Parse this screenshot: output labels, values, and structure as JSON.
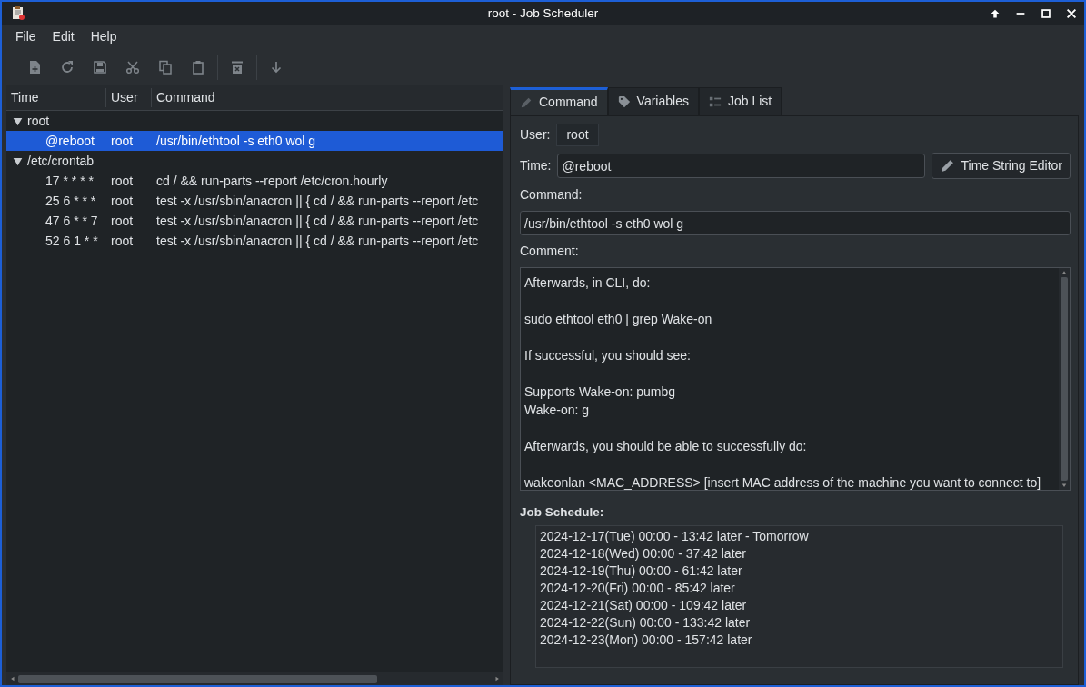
{
  "window": {
    "title": "root - Job Scheduler"
  },
  "menu": [
    "File",
    "Edit",
    "Help"
  ],
  "toolbar": [
    {
      "kind": "new"
    },
    {
      "kind": "reload"
    },
    {
      "kind": "save"
    },
    {
      "kind": "sep"
    },
    {
      "kind": "cut"
    },
    {
      "kind": "copy"
    },
    {
      "kind": "paste"
    },
    {
      "kind": "line"
    },
    {
      "kind": "delete"
    },
    {
      "kind": "line"
    },
    {
      "kind": "down"
    }
  ],
  "tree": {
    "columns": [
      "Time",
      "User",
      "Command"
    ],
    "groups": [
      {
        "label": "root",
        "expanded": true,
        "children": [
          {
            "time": "@reboot",
            "user": "root",
            "command": "/usr/bin/ethtool -s eth0 wol g",
            "selected": true
          }
        ]
      },
      {
        "label": "/etc/crontab",
        "expanded": true,
        "children": [
          {
            "time": "17 * * * *",
            "user": "root",
            "command": "cd / && run-parts --report /etc/cron.hourly",
            "selected": false
          },
          {
            "time": "25 6 * * *",
            "user": "root",
            "command": "test -x /usr/sbin/anacron || { cd / && run-parts --report /etc",
            "selected": false
          },
          {
            "time": "47 6 * * 7",
            "user": "root",
            "command": "test -x /usr/sbin/anacron || { cd / && run-parts --report /etc",
            "selected": false
          },
          {
            "time": "52 6 1 * *",
            "user": "root",
            "command": "test -x /usr/sbin/anacron || { cd / && run-parts --report /etc",
            "selected": false
          }
        ]
      }
    ]
  },
  "tabs": [
    {
      "label": "Command",
      "kind": "pencil",
      "selected": true
    },
    {
      "label": "Variables",
      "kind": "tag",
      "selected": false
    },
    {
      "label": "Job List",
      "kind": "list",
      "selected": false
    }
  ],
  "form": {
    "user_label": "User:",
    "user": "root",
    "time_label": "Time:",
    "time": "@reboot",
    "editor_button": "Time String Editor",
    "command_label": "Command:",
    "command": "/usr/bin/ethtool -s eth0 wol g",
    "comment_label": "Comment:",
    "comment": "Afterwards, in CLI, do:\n\nsudo ethtool eth0 | grep Wake-on\n\nIf successful, you should see:\n\nSupports Wake-on: pumbg\nWake-on: g\n\nAfterwards, you should be able to successfully do:\n\nwakeonlan <MAC_ADDRESS> [insert MAC address of the machine you want to connect to]",
    "schedule_label": "Job Schedule:",
    "schedule": [
      "2024-12-17(Tue) 00:00 - 13:42 later - Tomorrow",
      "2024-12-18(Wed) 00:00 - 37:42 later",
      "2024-12-19(Thu) 00:00 - 61:42 later",
      "2024-12-20(Fri) 00:00 - 85:42 later",
      "2024-12-21(Sat) 00:00 - 109:42 later",
      "2024-12-22(Sun) 00:00 - 133:42 later",
      "2024-12-23(Mon) 00:00 - 157:42 later"
    ]
  }
}
